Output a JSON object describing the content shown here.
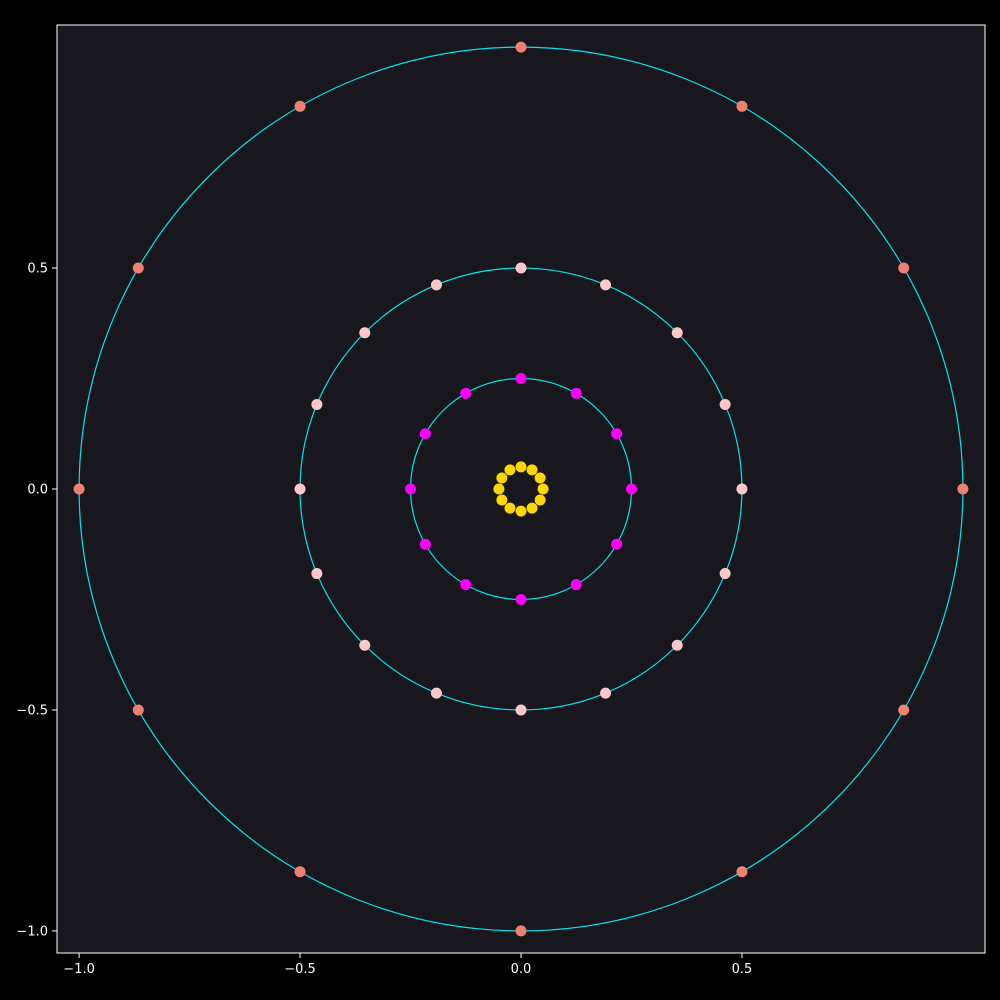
{
  "chart_data": {
    "type": "scatter",
    "title": "",
    "xlabel": "",
    "ylabel": "",
    "xlim": [
      -1.05,
      1.05
    ],
    "ylim": [
      -1.05,
      1.05
    ],
    "grid": false,
    "colors": {
      "figure_bg": "#000000",
      "axes_bg": "#18171d",
      "circles": "#00e5ee",
      "outer_points": "#f08070",
      "middle_points": "#ffc8c8",
      "inner_points": "#ff00ff",
      "core_points": "#ffd700",
      "text": "#ffffff"
    },
    "x_ticks": [
      {
        "value": -1.0,
        "label": "−1.0"
      },
      {
        "value": -0.5,
        "label": "−0.5"
      },
      {
        "value": 0.0,
        "label": "0.0"
      },
      {
        "value": 0.5,
        "label": "0.5"
      }
    ],
    "y_ticks": [
      {
        "value": 0.5,
        "label": "0.5"
      },
      {
        "value": 0.0,
        "label": "0.0"
      },
      {
        "value": -0.5,
        "label": "−0.5"
      },
      {
        "value": -1.0,
        "label": "−1.0"
      }
    ],
    "circles": [
      {
        "radius": 1.0
      },
      {
        "radius": 0.5
      },
      {
        "radius": 0.25
      }
    ],
    "series": [
      {
        "radius": 1.0,
        "count": 12,
        "color": "#f08070"
      },
      {
        "radius": 0.5,
        "count": 16,
        "color": "#ffc8c8"
      },
      {
        "radius": 0.25,
        "count": 12,
        "color": "#ff00ff"
      },
      {
        "radius": 0.05,
        "count": 12,
        "color": "#ffd700"
      }
    ]
  }
}
